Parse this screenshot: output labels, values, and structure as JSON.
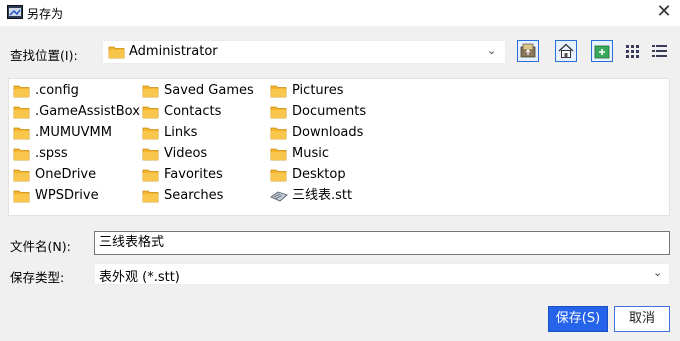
{
  "window": {
    "title": "另存为",
    "close_glyph": "✕"
  },
  "look_in": {
    "label": "查找位置(I):",
    "value": "Administrator"
  },
  "toolbar": {
    "icons": [
      "up-folder-icon",
      "home-icon",
      "new-folder-icon",
      "list-view-icon",
      "details-view-icon"
    ]
  },
  "files": {
    "col1": [
      ".config",
      ".GameAssistBox",
      ".MUMUVMM",
      ".spss",
      "OneDrive",
      "WPSDrive"
    ],
    "col2": [
      "Saved Games",
      "Contacts",
      "Links",
      "Videos",
      "Favorites",
      "Searches"
    ],
    "col3": [
      "Pictures",
      "Documents",
      "Downloads",
      "Music",
      "Desktop",
      "三线表.stt"
    ]
  },
  "file_name": {
    "label": "文件名(N):",
    "value": "三线表格式"
  },
  "file_type": {
    "label": "保存类型:",
    "value": "表外观 (*.stt)"
  },
  "buttons": {
    "save": "保存(S)",
    "cancel": "取消"
  },
  "colors": {
    "folder": "#f5b52e",
    "accent": "#2563eb"
  }
}
